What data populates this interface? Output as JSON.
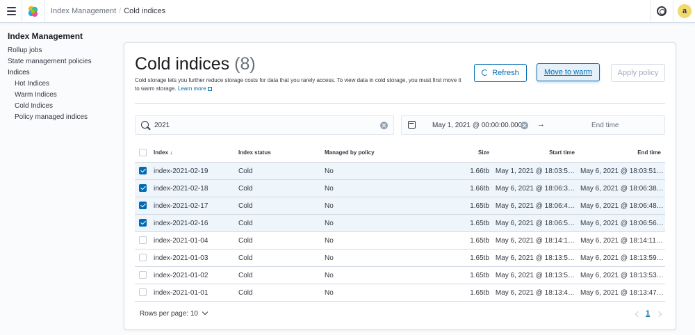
{
  "header": {
    "breadcrumbs": [
      "Index Management",
      "Cold indices"
    ],
    "avatar_initial": "a"
  },
  "sidebar": {
    "title": "Index Management",
    "items": [
      {
        "label": "Rollup jobs"
      },
      {
        "label": "State management policies"
      },
      {
        "label": "Indices"
      },
      {
        "label": "Hot Indices"
      },
      {
        "label": "Warm Indices"
      },
      {
        "label": "Cold Indices"
      },
      {
        "label": "Policy managed indices"
      }
    ]
  },
  "page": {
    "title": "Cold indices",
    "count": "(8)",
    "description": "Cold storage lets you further reduce storage costs for data that you rarely access. To view data in cold storage, you must first move it to warm storage.",
    "learn_more": "Learn more",
    "buttons": {
      "refresh": "Refresh",
      "move_to_warm": "Move to warm",
      "apply_policy": "Apply policy"
    }
  },
  "search": {
    "value": "2021"
  },
  "date_range": {
    "start": "May 1, 2021 @ 00:00:00.000",
    "arrow": "→",
    "end_placeholder": "End time"
  },
  "table": {
    "columns": [
      "Index",
      "Index status",
      "Managed by policy",
      "Size",
      "Start time",
      "End time"
    ],
    "rows": [
      {
        "checked": true,
        "index": "index-2021-02-19",
        "status": "Cold",
        "managed": "No",
        "size": "1.66tb",
        "start": "May 1, 2021 @ 18:03:5…",
        "end": "May 6, 2021 @ 18:03:51…"
      },
      {
        "checked": true,
        "index": "index-2021-02-18",
        "status": "Cold",
        "managed": "No",
        "size": "1.66tb",
        "start": "May 6, 2021 @ 18:06:3…",
        "end": "May 6, 2021 @ 18:06:38…"
      },
      {
        "checked": true,
        "index": "index-2021-02-17",
        "status": "Cold",
        "managed": "No",
        "size": "1.65tb",
        "start": "May 6, 2021 @ 18:06:4…",
        "end": "May 6, 2021 @ 18:06:48…"
      },
      {
        "checked": true,
        "index": "index-2021-02-16",
        "status": "Cold",
        "managed": "No",
        "size": "1.65tb",
        "start": "May 6, 2021 @ 18:06:5…",
        "end": "May 6, 2021 @ 18:06:56…"
      },
      {
        "checked": false,
        "index": "index-2021-01-04",
        "status": "Cold",
        "managed": "No",
        "size": "1.65tb",
        "start": "May 6, 2021 @ 18:14:1…",
        "end": "May 6, 2021 @ 18:14:11…"
      },
      {
        "checked": false,
        "index": "index-2021-01-03",
        "status": "Cold",
        "managed": "No",
        "size": "1.65tb",
        "start": "May 6, 2021 @ 18:13:5…",
        "end": "May 6, 2021 @ 18:13:59…"
      },
      {
        "checked": false,
        "index": "index-2021-01-02",
        "status": "Cold",
        "managed": "No",
        "size": "1.65tb",
        "start": "May 6, 2021 @ 18:13:5…",
        "end": "May 6, 2021 @ 18:13:53…"
      },
      {
        "checked": false,
        "index": "index-2021-01-01",
        "status": "Cold",
        "managed": "No",
        "size": "1.65tb",
        "start": "May 6, 2021 @ 18:13:4…",
        "end": "May 6, 2021 @ 18:13:47…"
      }
    ]
  },
  "pagination": {
    "rows_per_page": "Rows per page: 10",
    "current_page": "1"
  },
  "colors": {
    "accent": "#006bb4",
    "selected_row": "#eef5fb",
    "avatar": "#f1d86f"
  }
}
